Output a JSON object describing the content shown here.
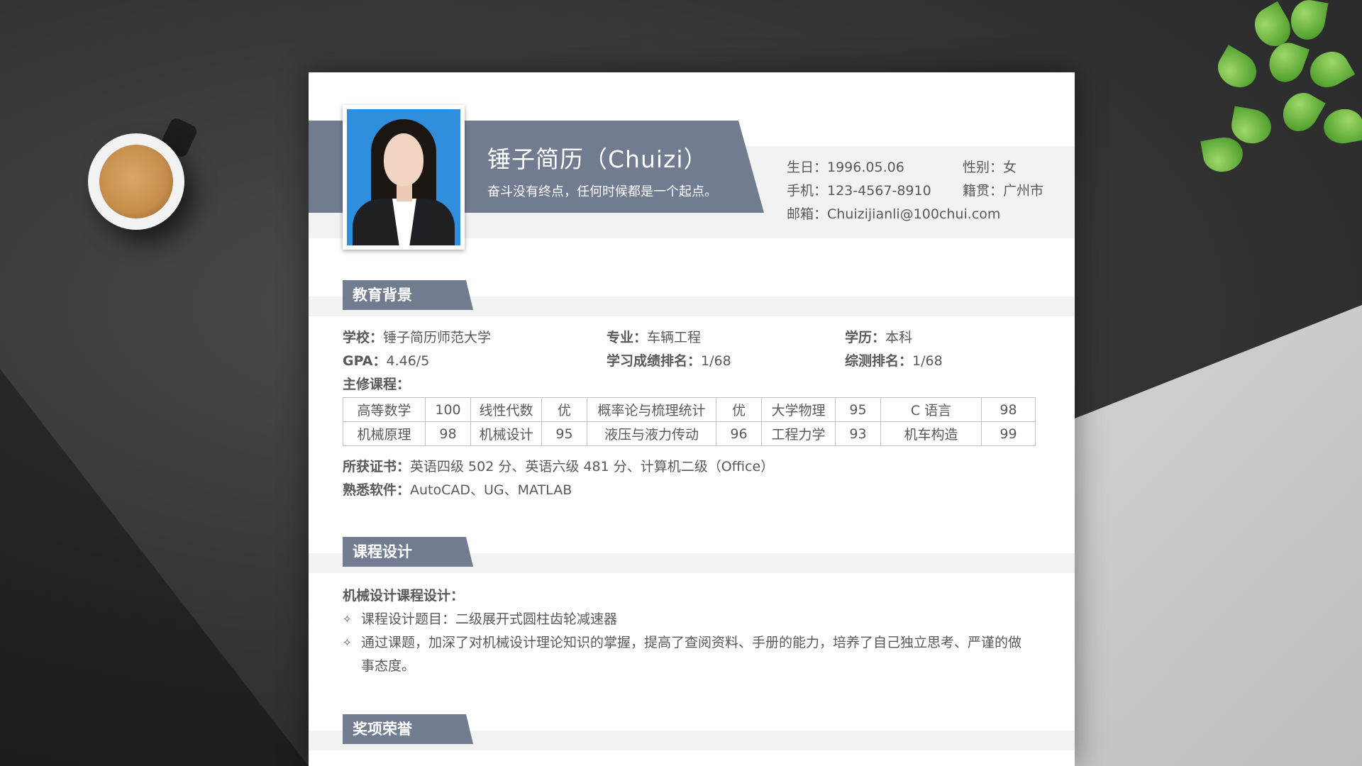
{
  "header": {
    "name": "锤子简历（Chuizi）",
    "motto": "奋斗没有终点，任何时候都是一个起点。",
    "info": {
      "birth": "生日：1996.05.06",
      "gender": "性别：女",
      "phone": "手机：123-4567-8910",
      "hometown": "籍贯：广州市",
      "email": "邮箱：Chuizijianli@100chui.com"
    }
  },
  "education": {
    "title": "教育背景",
    "school_label": "学校：",
    "school": "锤子简历师范大学",
    "major_label": "专业：",
    "major": "车辆工程",
    "degree_label": "学历：",
    "degree": "本科",
    "gpa_label": "GPA：",
    "gpa": "4.46/5",
    "rank_label": "学习成绩排名：",
    "rank": "1/68",
    "overall_label": "综测排名：",
    "overall": "1/68",
    "courses_label": "主修课程：",
    "courses": [
      [
        "高等数学",
        "100",
        "线性代数",
        "优",
        "概率论与梳理统计",
        "优",
        "大学物理",
        "95",
        "C 语言",
        "98"
      ],
      [
        "机械原理",
        "98",
        "机械设计",
        "95",
        "液压与液力传动",
        "96",
        "工程力学",
        "93",
        "机车构造",
        "99"
      ]
    ],
    "cert_label": "所获证书：",
    "cert": "英语四级 502 分、英语六级 481 分、计算机二级（Office）",
    "software_label": "熟悉软件：",
    "software": "AutoCAD、UG、MATLAB"
  },
  "course_design": {
    "title": "课程设计",
    "subtitle": "机械设计课程设计：",
    "bullet_symbol": "✧",
    "items": [
      "课程设计题目：二级展开式圆柱齿轮减速器",
      "通过课题，加深了对机械设计理论知识的掌握，提高了查阅资料、手册的能力，培养了自己独立思考、严谨的做",
      "事态度。"
    ]
  },
  "awards": {
    "title": "奖项荣誉"
  },
  "colors": {
    "accent": "#717c91",
    "band": "#f2f2f2",
    "text": "#595959",
    "table_border": "#bfbfbf"
  }
}
